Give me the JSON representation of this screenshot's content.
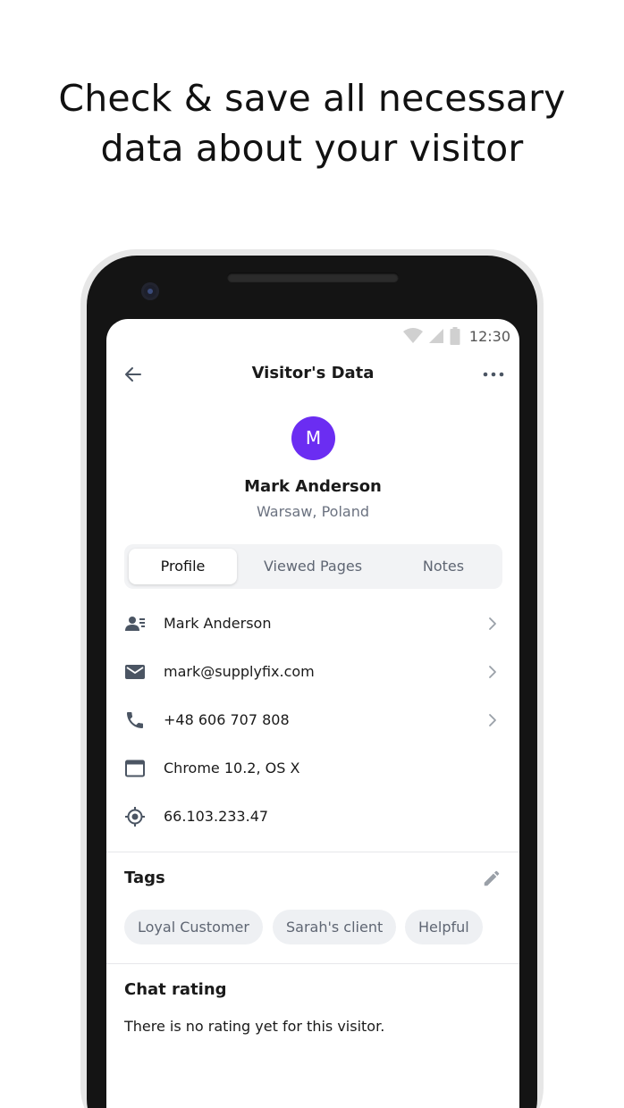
{
  "headline": {
    "line1": "Check & save all necessary",
    "line2": "data about your visitor"
  },
  "status_bar": {
    "time": "12:30",
    "icons": [
      "wifi-icon",
      "signal-icon",
      "battery-icon"
    ]
  },
  "header": {
    "title": "Visitor's Data",
    "back_icon": "arrow-left-icon",
    "more_icon": "more-horizontal-icon"
  },
  "visitor": {
    "initial": "M",
    "name": "Mark Anderson",
    "location": "Warsaw, Poland",
    "avatar_color": "#6b2df2"
  },
  "tabs": [
    {
      "label": "Profile",
      "active": true
    },
    {
      "label": "Viewed Pages",
      "active": false
    },
    {
      "label": "Notes",
      "active": false
    }
  ],
  "details": [
    {
      "icon": "person-card-icon",
      "text": "Mark Anderson",
      "chevron": true
    },
    {
      "icon": "mail-icon",
      "text": "mark@supplyfix.com",
      "chevron": true
    },
    {
      "icon": "phone-icon",
      "text": "+48 606 707 808",
      "chevron": true
    },
    {
      "icon": "browser-window-icon",
      "text": "Chrome 10.2, OS X",
      "chevron": false
    },
    {
      "icon": "location-target-icon",
      "text": "66.103.233.47",
      "chevron": false
    }
  ],
  "tags_section": {
    "title": "Tags",
    "edit_icon": "pencil-icon",
    "tags": [
      "Loyal Customer",
      "Sarah's client",
      "Helpful"
    ]
  },
  "rating_section": {
    "title": "Chat rating",
    "text": "There is no rating yet for this visitor."
  }
}
